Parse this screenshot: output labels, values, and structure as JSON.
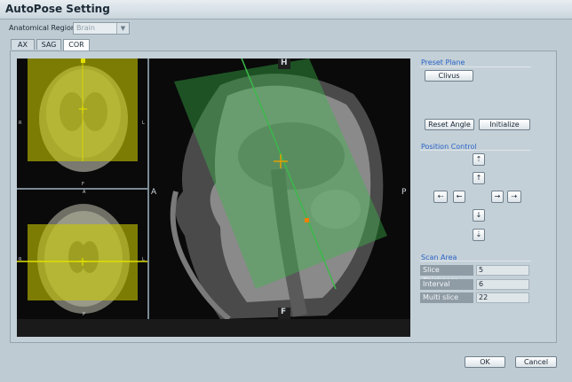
{
  "window": {
    "title": "AutoPose Setting"
  },
  "region": {
    "label": "Anatomical Region",
    "value": "Brain"
  },
  "tabs": [
    {
      "label": "AX"
    },
    {
      "label": "SAG"
    },
    {
      "label": "COR"
    }
  ],
  "viewer": {
    "main_labels": {
      "top": "H",
      "bottom": "F",
      "left": "A",
      "right": "P"
    },
    "coronal_labels": {
      "left": "R",
      "right": "L",
      "top": "H",
      "bottom": "F"
    },
    "axial_labels": {
      "left": "R",
      "right": "L",
      "top": "A",
      "bottom": "P"
    }
  },
  "preset_plane": {
    "header": "Preset Plane",
    "button": "Clivus"
  },
  "angle_buttons": {
    "reset": "Reset Angle",
    "initialize": "Initialize"
  },
  "position_control": {
    "header": "Position Control"
  },
  "scan_area": {
    "header": "Scan Area",
    "params": [
      {
        "label": "Slice Thickness",
        "value": "5"
      },
      {
        "label": "Interval",
        "value": "6"
      },
      {
        "label": "Multi slice",
        "value": "22"
      }
    ]
  },
  "dialog": {
    "ok": "OK",
    "cancel": "Cancel"
  },
  "colors": {
    "highlight": "#e0e000",
    "plane_green": "#3cb84a",
    "accent": "#2a64c8"
  }
}
